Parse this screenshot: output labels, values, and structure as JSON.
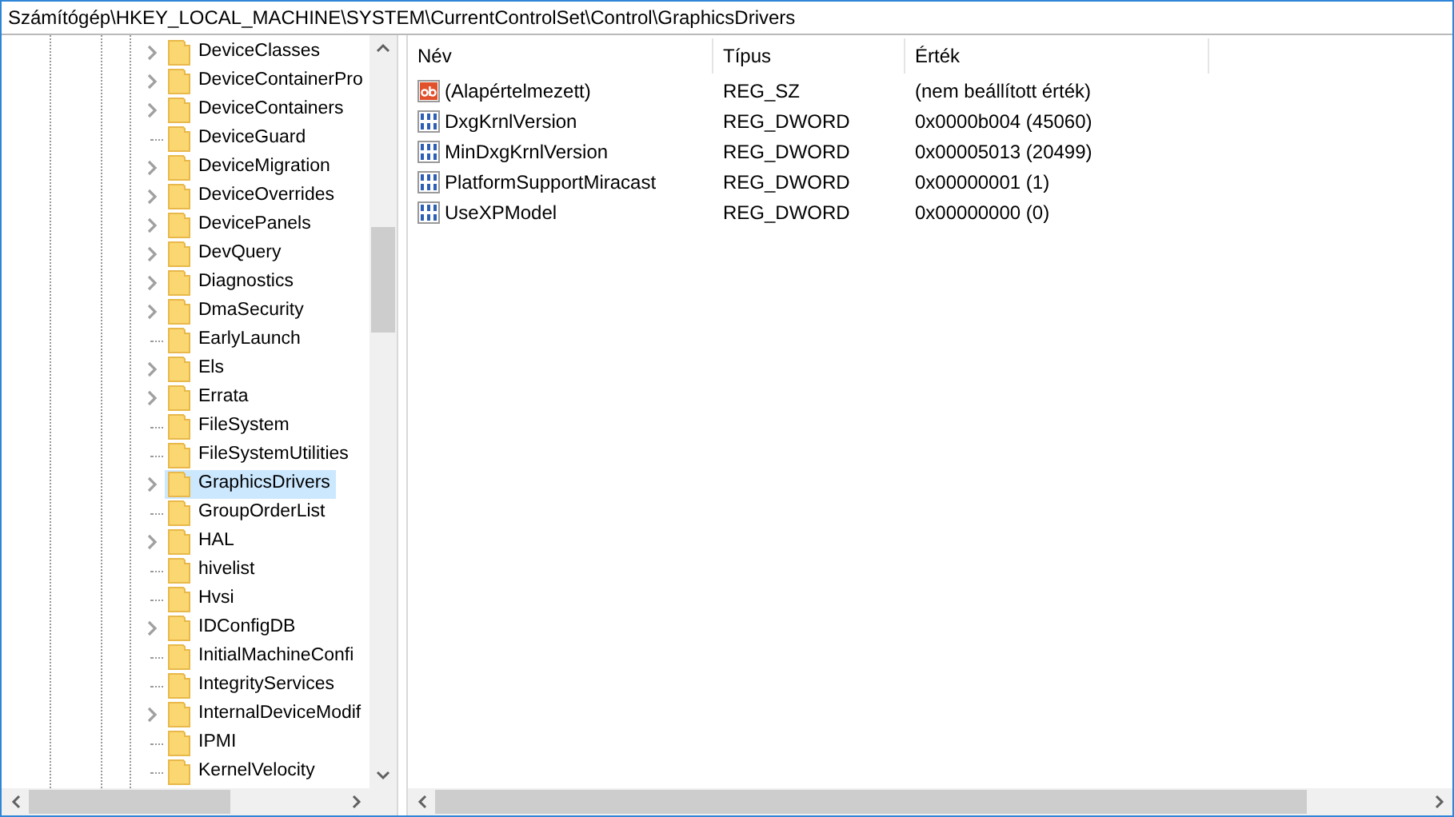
{
  "address": "Számítógép\\HKEY_LOCAL_MACHINE\\SYSTEM\\CurrentControlSet\\Control\\GraphicsDrivers",
  "tree": [
    {
      "label": "DeviceClasses",
      "kind": "expandable",
      "selected": false
    },
    {
      "label": "DeviceContainerPro",
      "kind": "expandable",
      "selected": false
    },
    {
      "label": "DeviceContainers",
      "kind": "expandable",
      "selected": false
    },
    {
      "label": "DeviceGuard",
      "kind": "leaf",
      "selected": false
    },
    {
      "label": "DeviceMigration",
      "kind": "expandable",
      "selected": false
    },
    {
      "label": "DeviceOverrides",
      "kind": "expandable",
      "selected": false
    },
    {
      "label": "DevicePanels",
      "kind": "expandable",
      "selected": false
    },
    {
      "label": "DevQuery",
      "kind": "expandable",
      "selected": false
    },
    {
      "label": "Diagnostics",
      "kind": "expandable",
      "selected": false
    },
    {
      "label": "DmaSecurity",
      "kind": "expandable",
      "selected": false
    },
    {
      "label": "EarlyLaunch",
      "kind": "leaf",
      "selected": false
    },
    {
      "label": "Els",
      "kind": "expandable",
      "selected": false
    },
    {
      "label": "Errata",
      "kind": "expandable",
      "selected": false
    },
    {
      "label": "FileSystem",
      "kind": "leaf",
      "selected": false
    },
    {
      "label": "FileSystemUtilities",
      "kind": "leaf",
      "selected": false
    },
    {
      "label": "GraphicsDrivers",
      "kind": "expandable",
      "selected": true
    },
    {
      "label": "GroupOrderList",
      "kind": "leaf",
      "selected": false
    },
    {
      "label": "HAL",
      "kind": "expandable",
      "selected": false
    },
    {
      "label": "hivelist",
      "kind": "leaf",
      "selected": false
    },
    {
      "label": "Hvsi",
      "kind": "leaf",
      "selected": false
    },
    {
      "label": "IDConfigDB",
      "kind": "expandable",
      "selected": false
    },
    {
      "label": "InitialMachineConfi",
      "kind": "leaf",
      "selected": false
    },
    {
      "label": "IntegrityServices",
      "kind": "leaf",
      "selected": false
    },
    {
      "label": "InternalDeviceModif",
      "kind": "expandable",
      "selected": false
    },
    {
      "label": "IPMI",
      "kind": "leaf",
      "selected": false
    },
    {
      "label": "KernelVelocity",
      "kind": "leaf",
      "selected": false
    }
  ],
  "columns": [
    "Név",
    "Típus",
    "Érték"
  ],
  "values": [
    {
      "name": "(Alapértelmezett)",
      "kind": "string",
      "type": "REG_SZ",
      "data": "(nem beállított érték)"
    },
    {
      "name": "DxgKrnlVersion",
      "kind": "dword",
      "type": "REG_DWORD",
      "data": "0x0000b004 (45060)"
    },
    {
      "name": "MinDxgKrnlVersion",
      "kind": "dword",
      "type": "REG_DWORD",
      "data": "0x00005013 (20499)"
    },
    {
      "name": "PlatformSupportMiracast",
      "kind": "dword",
      "type": "REG_DWORD",
      "data": "0x00000001 (1)"
    },
    {
      "name": "UseXPModel",
      "kind": "dword",
      "type": "REG_DWORD",
      "data": "0x00000000 (0)"
    }
  ]
}
